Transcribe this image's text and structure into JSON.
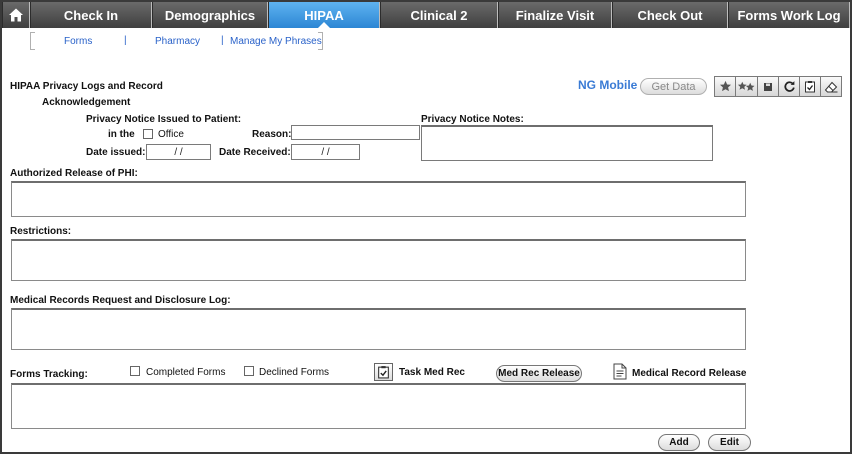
{
  "tabs": [
    {
      "label": "",
      "icon": "home-icon"
    },
    {
      "label": "Check In"
    },
    {
      "label": "Demographics"
    },
    {
      "label": "HIPAA",
      "active": true
    },
    {
      "label": "Clinical 2"
    },
    {
      "label": "Finalize Visit"
    },
    {
      "label": "Check Out"
    },
    {
      "label": "Forms Work Log"
    }
  ],
  "subnav": {
    "forms": "Forms",
    "sep1": "|",
    "pharmacy": "Pharmacy",
    "sep2": "|",
    "phrases": "Manage My Phrases"
  },
  "header": {
    "title_line1": "HIPAA Privacy Logs and Record",
    "title_line2": "Acknowledgement",
    "ng_mobile": "NG Mobile",
    "get_data": "Get Data"
  },
  "toolbar": {
    "icons": [
      "star-icon",
      "double-star-icon",
      "save-icon",
      "refresh-icon",
      "clipboard-check-icon",
      "eraser-icon"
    ]
  },
  "privacy": {
    "notice_label": "Privacy Notice Issued to Patient:",
    "in_the": "in the",
    "office": "Office",
    "reason_label": "Reason:",
    "reason_value": "",
    "date_issued_label": "Date issued:",
    "date_issued_value": "/ /",
    "date_received_label": "Date Received:",
    "date_received_value": "/ /",
    "notes_label": "Privacy Notice Notes:"
  },
  "sections": {
    "authorized": "Authorized Release of PHI:",
    "restrictions": "Restrictions:",
    "medical_log": "Medical Records Request and Disclosure Log:",
    "forms_tracking": "Forms Tracking:"
  },
  "forms": {
    "completed": "Completed Forms",
    "declined": "Declined Forms",
    "task_med_rec": "Task Med Rec",
    "med_rec_release_btn": "Med Rec Release",
    "medical_record_release": "Medical Record Release"
  },
  "actions": {
    "add": "Add",
    "edit": "Edit"
  },
  "colors": {
    "tab_bg": "#4d4d4d",
    "tab_active": "#2c86d4",
    "link": "#2a62c9",
    "ng_mobile": "#3a7bd5"
  }
}
